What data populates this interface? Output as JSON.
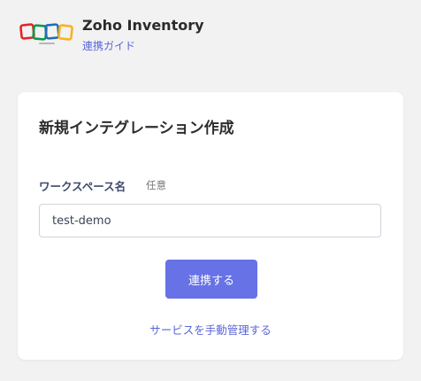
{
  "header": {
    "logo_icon": "zoho-logo-icon",
    "logo_colors": [
      "#e42527",
      "#089949",
      "#226db4",
      "#f9b21d"
    ],
    "app_name": "Zoho Inventory",
    "guide_link": "連携ガイド"
  },
  "card": {
    "title": "新規インテグレーション作成",
    "workspace_field": {
      "label": "ワークスペース名",
      "optional_tag": "任意",
      "value": "test-demo"
    },
    "connect_button": "連携する",
    "manual_link": "サービスを手動管理する"
  },
  "colors": {
    "accent": "#6672e6",
    "link": "#5a67d8",
    "background": "#f2f2f2"
  }
}
